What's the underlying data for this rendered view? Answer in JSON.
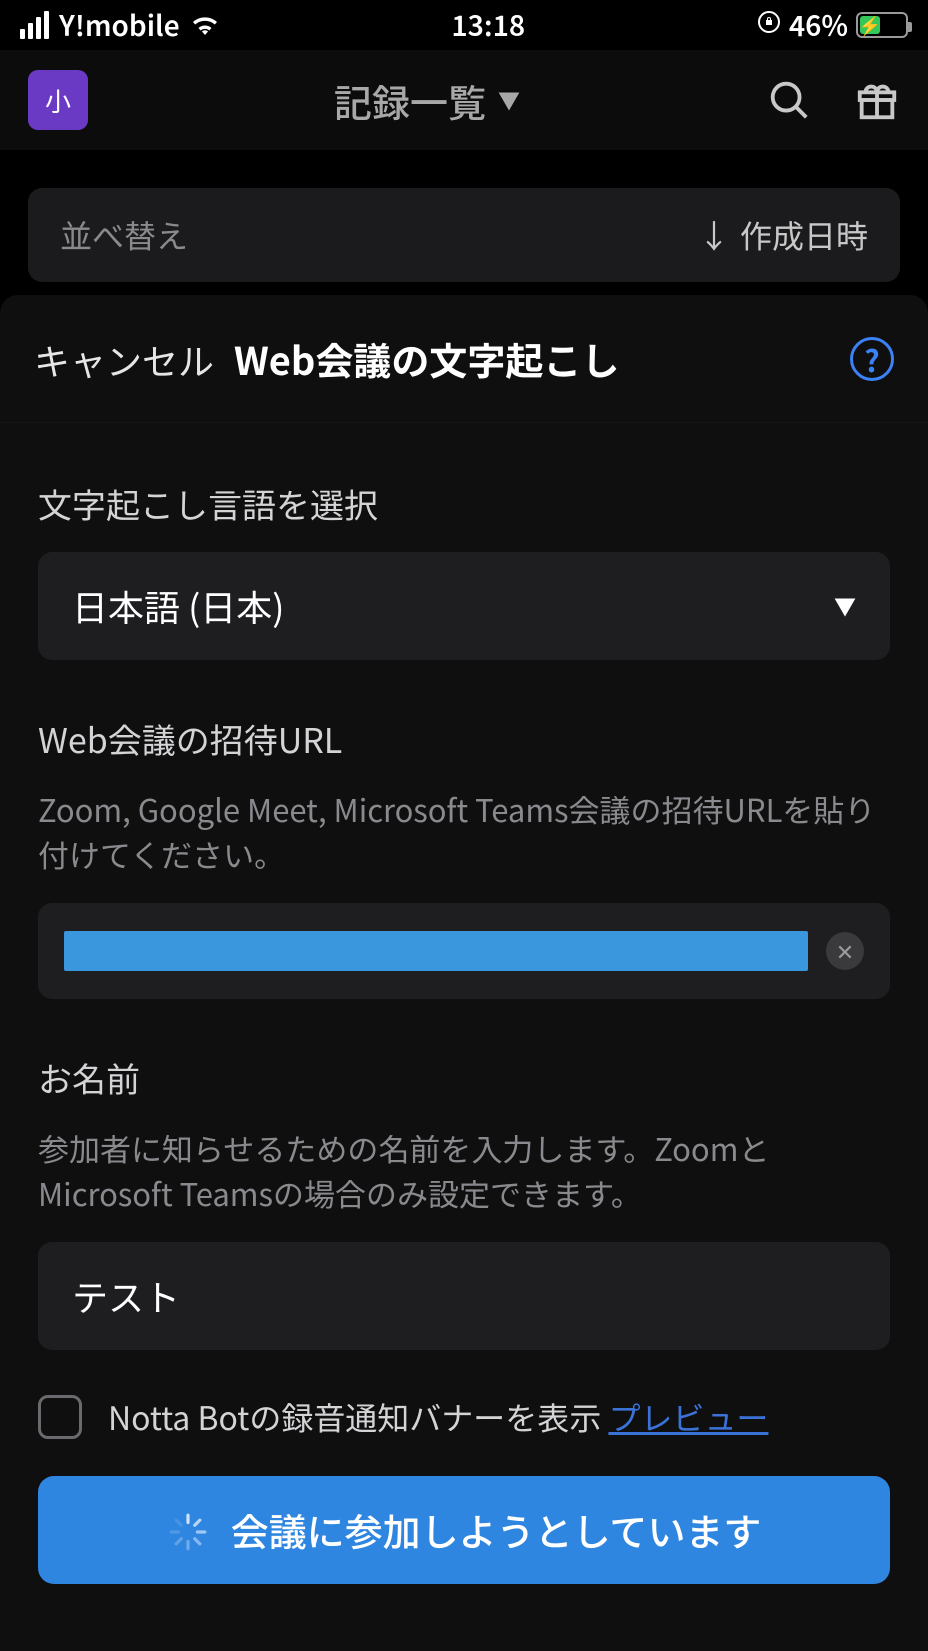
{
  "status_bar": {
    "carrier": "Y!mobile",
    "time": "13:18",
    "battery_percent": "46%"
  },
  "app_header": {
    "avatar_letter": "小",
    "title": "記録一覧"
  },
  "sort_bar": {
    "label": "並べ替え",
    "sort_value": "作成日時"
  },
  "modal": {
    "cancel": "キャンセル",
    "title": "Web会議の文字起こし",
    "help": "?",
    "language": {
      "label": "文字起こし言語を選択",
      "value": "日本語 (日本)"
    },
    "url": {
      "label": "Web会議の招待URL",
      "subtext": "Zoom, Google Meet, Microsoft Teams会議の招待URLを貼り付けてください。"
    },
    "name": {
      "label": "お名前",
      "subtext": "参加者に知らせるための名前を入力します。ZoomとMicrosoft Teamsの場合のみ設定できます。",
      "value": "テスト"
    },
    "checkbox": {
      "label": "Notta Botの録音通知バナーを表示 ",
      "preview": "プレビュー"
    },
    "join_button": "会議に参加しようとしています"
  }
}
